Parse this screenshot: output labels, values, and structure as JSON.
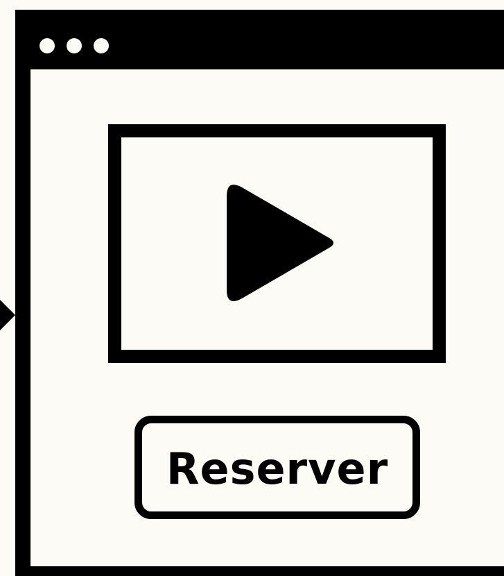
{
  "window": {
    "title_dots": [
      "dot",
      "dot",
      "dot"
    ]
  },
  "video": {
    "icon": "play-icon"
  },
  "actions": {
    "reserve_label": "Reserver"
  },
  "colors": {
    "background": "#fcfbf6",
    "foreground": "#000000"
  }
}
